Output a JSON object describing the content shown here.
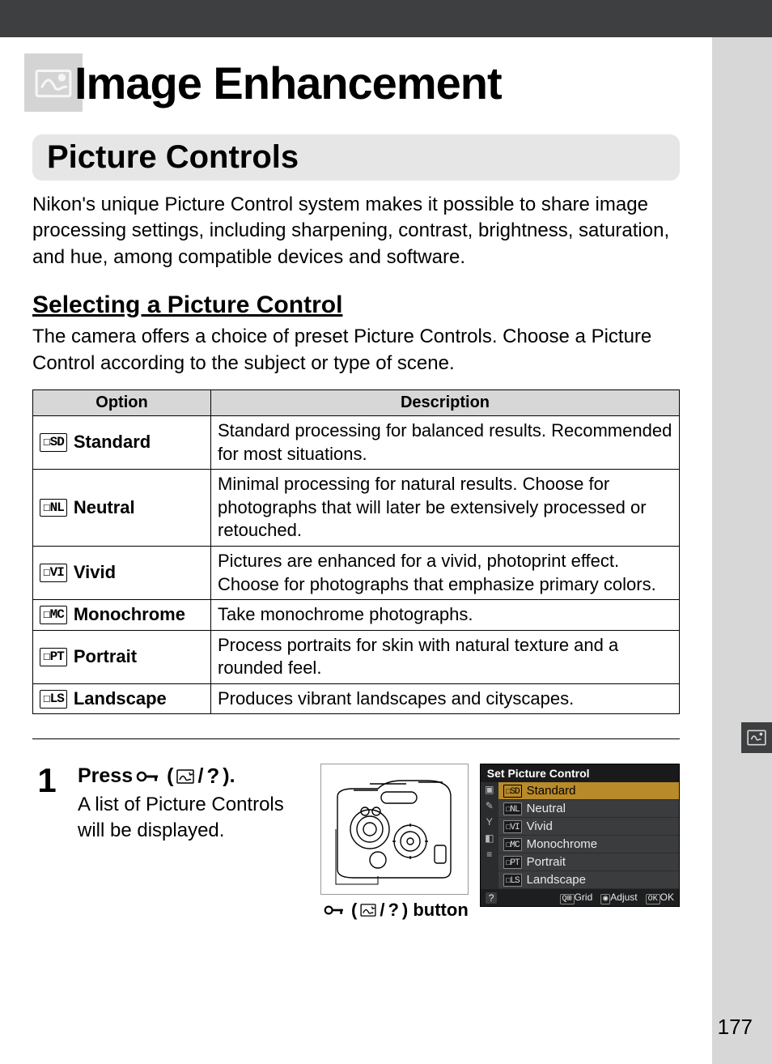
{
  "chapter_title": "Image Enhancement",
  "subheading": "Picture Controls",
  "intro": "Nikon's unique Picture Control system makes it possible to share image processing settings, including sharpening, contrast, brightness, saturation, and hue, among compatible devices and software.",
  "subsection": "Selecting a Picture Control",
  "subsection_intro": "The camera offers a choice of preset Picture Controls.  Choose a Picture Control according to the subject or type of scene.",
  "table_headers": {
    "option": "Option",
    "description": "Description"
  },
  "table_rows": [
    {
      "code": "SD",
      "name": "Standard",
      "desc": "Standard processing for balanced results. Recommended for most situations."
    },
    {
      "code": "NL",
      "name": "Neutral",
      "desc": "Minimal processing for natural results.  Choose for photographs that will later be extensively processed or retouched."
    },
    {
      "code": "VI",
      "name": "Vivid",
      "desc": "Pictures are enhanced for a vivid, photoprint effect. Choose for photographs that emphasize primary colors."
    },
    {
      "code": "MC",
      "name": "Monochrome",
      "desc": "Take monochrome photographs."
    },
    {
      "code": "PT",
      "name": "Portrait",
      "desc": "Process portraits for skin with natural texture and a rounded feel."
    },
    {
      "code": "LS",
      "name": "Landscape",
      "desc": "Produces vibrant landscapes and cityscapes."
    }
  ],
  "step": {
    "num": "1",
    "head_prefix": "Press ",
    "head_suffix": ").",
    "body": "A list of Picture Controls will be displayed.",
    "caption_suffix": ") button"
  },
  "lcd": {
    "title": "Set Picture Control",
    "items": [
      {
        "code": "SD",
        "label": "Standard",
        "selected": true
      },
      {
        "code": "NL",
        "label": "Neutral",
        "selected": false
      },
      {
        "code": "VI",
        "label": "Vivid",
        "selected": false
      },
      {
        "code": "MC",
        "label": "Monochrome",
        "selected": false
      },
      {
        "code": "PT",
        "label": "Portrait",
        "selected": false
      },
      {
        "code": "LS",
        "label": "Landscape",
        "selected": false
      }
    ],
    "footer": {
      "grid": "Grid",
      "adjust": "Adjust",
      "ok": "OK"
    }
  },
  "page_number": "177"
}
